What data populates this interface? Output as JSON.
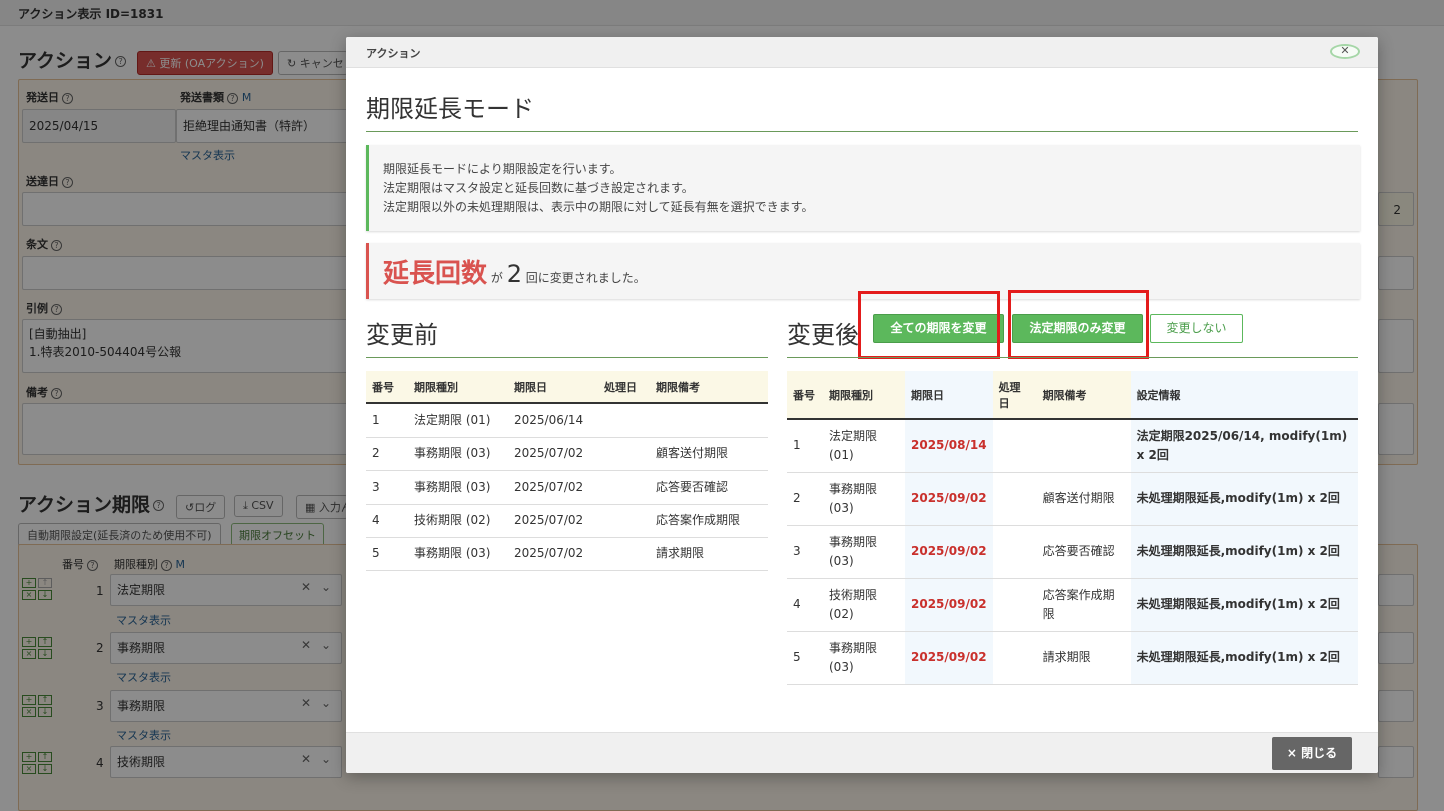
{
  "page": {
    "top_title": "アクション表示 ID=1831",
    "action_title": "アクション",
    "update_button": "更新 (OAアクション)",
    "cancel_button": "キャンセ",
    "fields": {
      "send_date_label": "発送日",
      "send_date_value": "2025/04/15",
      "doc_type_label": "発送書類",
      "doc_type_m": "M",
      "doc_type_value": "拒絶理由通知書（特許）",
      "master_link": "マスタ表示",
      "delivery_date_label": "送達日",
      "article_label": "条文",
      "citation_label": "引例",
      "citation_value": "[自動抽出]\n1.特表2010-504404号公報",
      "memo_label": "備考",
      "spinner_value": "2"
    },
    "deadline_title": "アクション期限",
    "log_button": "ログ",
    "csv_button": "CSV",
    "input_button": "入力ん",
    "auto_button": "自動期限設定(延長済のため使用不可)",
    "offset_button": "期限オフセット",
    "deadline_table": {
      "col_num": "番号",
      "col_type": "期限種別",
      "col_m": "M",
      "master_link": "マスタ表示",
      "rows": [
        {
          "num": "1",
          "type": "法定期限"
        },
        {
          "num": "2",
          "type": "事務期限"
        },
        {
          "num": "3",
          "type": "事務期限"
        },
        {
          "num": "4",
          "type": "技術期限"
        }
      ]
    }
  },
  "modal": {
    "header": "アクション",
    "close_x": "✕",
    "title": "期限延長モード",
    "info_lines": [
      "期限延長モードにより期限設定を行います。",
      "法定期限はマスタ設定と延長回数に基づき設定されます。",
      "法定期限以外の未処理期限は、表示中の期限に対して延長有無を選択できます。"
    ],
    "alert": {
      "label": "延長回数",
      "ga": "が",
      "count": "2",
      "suffix": "回に変更されました。"
    },
    "before": {
      "title": "変更前",
      "headers": [
        "番号",
        "期限種別",
        "期限日",
        "処理日",
        "期限備考"
      ],
      "rows": [
        [
          "1",
          "法定期限 (01)",
          "2025/06/14",
          "",
          ""
        ],
        [
          "2",
          "事務期限 (03)",
          "2025/07/02",
          "",
          "顧客送付期限"
        ],
        [
          "3",
          "事務期限 (03)",
          "2025/07/02",
          "",
          "応答要否確認"
        ],
        [
          "4",
          "技術期限 (02)",
          "2025/07/02",
          "",
          "応答案作成期限"
        ],
        [
          "5",
          "事務期限 (03)",
          "2025/07/02",
          "",
          "請求期限"
        ]
      ]
    },
    "after": {
      "title": "変更後",
      "btn_all": "全ての期限を変更",
      "btn_legal": "法定期限のみ変更",
      "btn_none": "変更しない",
      "headers": [
        "番号",
        "期限種別",
        "期限日",
        "処理日",
        "期限備考",
        "設定情報"
      ],
      "rows": [
        [
          "1",
          "法定期限 (01)",
          "2025/08/14",
          "",
          "",
          "法定期限2025/06/14, modify(1m) x 2回"
        ],
        [
          "2",
          "事務期限 (03)",
          "2025/09/02",
          "",
          "顧客送付期限",
          "未処理期限延長,modify(1m) x 2回"
        ],
        [
          "3",
          "事務期限 (03)",
          "2025/09/02",
          "",
          "応答要否確認",
          "未処理期限延長,modify(1m) x 2回"
        ],
        [
          "4",
          "技術期限 (02)",
          "2025/09/02",
          "",
          "応答案作成期限",
          "未処理期限延長,modify(1m) x 2回"
        ],
        [
          "5",
          "事務期限 (03)",
          "2025/09/02",
          "",
          "請求期限",
          "未処理期限延長,modify(1m) x 2回"
        ]
      ]
    },
    "footer_close": "× 閉じる"
  }
}
